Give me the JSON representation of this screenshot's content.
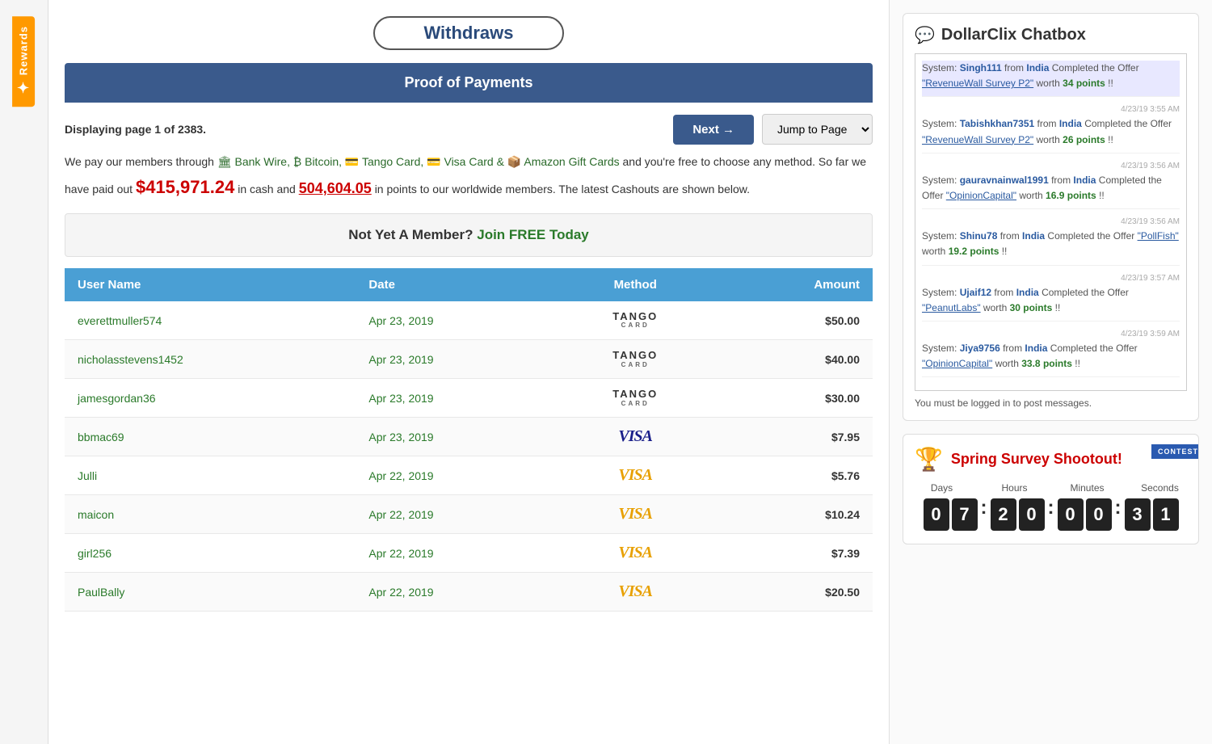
{
  "page": {
    "title": "Withdraws"
  },
  "sidebar": {
    "rewards_label": "Rewards"
  },
  "header": {
    "proof_title": "Proof of Payments"
  },
  "pagination": {
    "info": "Displaying page 1 of 2383.",
    "next_label": "Next →",
    "jump_label": "Jump to Page"
  },
  "description": {
    "intro": "We pay our members through",
    "methods": "Bank Wire, Bitcoin, Tango Card, Visa Card &",
    "amazon": "Amazon Gift Cards",
    "mid": "and you're free to choose any method. So far we have paid out",
    "cash_amount": "$415,971.24",
    "mid2": "in cash and",
    "points_amount": "504,604.05",
    "end": "in points to our worldwide members. The latest Cashouts are shown below."
  },
  "join_banner": {
    "text": "Not Yet A Member?",
    "link": "Join FREE Today"
  },
  "table": {
    "headers": [
      "User Name",
      "Date",
      "Method",
      "Amount"
    ],
    "rows": [
      {
        "username": "everettmuller574",
        "date": "Apr 23, 2019",
        "method": "tango",
        "amount": "$50.00"
      },
      {
        "username": "nicholasstevens1452",
        "date": "Apr 23, 2019",
        "method": "tango",
        "amount": "$40.00"
      },
      {
        "username": "jamesgordan36",
        "date": "Apr 23, 2019",
        "method": "tango",
        "amount": "$30.00"
      },
      {
        "username": "bbmac69",
        "date": "Apr 23, 2019",
        "method": "visa",
        "amount": "$7.95"
      },
      {
        "username": "Julli",
        "date": "Apr 22, 2019",
        "method": "visa_gold",
        "amount": "$5.76"
      },
      {
        "username": "maicon",
        "date": "Apr 22, 2019",
        "method": "visa_gold",
        "amount": "$10.24"
      },
      {
        "username": "girl256",
        "date": "Apr 22, 2019",
        "method": "visa_gold",
        "amount": "$7.39"
      },
      {
        "username": "PaulBally",
        "date": "Apr 22, 2019",
        "method": "visa_gold",
        "amount": "$20.50"
      }
    ]
  },
  "chatbox": {
    "title": "DollarClix Chatbox",
    "entries": [
      {
        "timestamp": "",
        "system": "System: ",
        "user": "Singh111",
        "from": " from ",
        "country": "India",
        "action": " Completed the Offer ",
        "offer": "\"RevenueWall Survey P2\"",
        "worth": " worth ",
        "points": "34 points",
        "end": " !!",
        "highlighted": true
      },
      {
        "timestamp": "4/23/19 3:55 AM",
        "system": "System: ",
        "user": "Tabishkhan7351",
        "from": " from ",
        "country": "India",
        "action": " Completed the Offer ",
        "offer": "\"RevenueWall Survey P2\"",
        "worth": " worth ",
        "points": "26 points",
        "end": " !!",
        "highlighted": false
      },
      {
        "timestamp": "4/23/19 3:56 AM",
        "system": "System: ",
        "user": "gauravnainwal1991",
        "from": " from ",
        "country": "India",
        "action": " Completed the Offer ",
        "offer": "\"OpinionCapital\"",
        "worth": " worth ",
        "points": "16.9 points",
        "end": " !!",
        "highlighted": false
      },
      {
        "timestamp": "4/23/19 3:56 AM",
        "system": "System: ",
        "user": "Shinu78",
        "from": " from ",
        "country": "India",
        "action": " Completed the Offer ",
        "offer": "\"PollFish\"",
        "worth": " worth ",
        "points": "19.2 points",
        "end": " !!",
        "highlighted": false
      },
      {
        "timestamp": "4/23/19 3:57 AM",
        "system": "System: ",
        "user": "Ujaif12",
        "from": " from ",
        "country": "India",
        "action": " Completed the Offer ",
        "offer": "\"PeanutLabs\"",
        "worth": " worth ",
        "points": "30 points",
        "end": " !!",
        "highlighted": false
      },
      {
        "timestamp": "4/23/19 3:59 AM",
        "system": "System: ",
        "user": "Jiya9756",
        "from": " from ",
        "country": "India",
        "action": " Completed the Offer ",
        "offer": "\"OpinionCapital\"",
        "worth": " worth ",
        "points": "33.8 points",
        "end": " !!",
        "highlighted": false
      }
    ],
    "login_msg": "You must be logged in to post messages."
  },
  "contest": {
    "ribbon": "CONTEST",
    "title": "Spring Survey Shootout!",
    "countdown": {
      "days_label": "Days",
      "hours_label": "Hours",
      "minutes_label": "Minutes",
      "seconds_label": "Seconds",
      "days": [
        "0",
        "7"
      ],
      "hours": [
        "2",
        "0"
      ],
      "minutes": [
        "0",
        "0"
      ],
      "seconds": [
        "3",
        "1"
      ]
    }
  }
}
